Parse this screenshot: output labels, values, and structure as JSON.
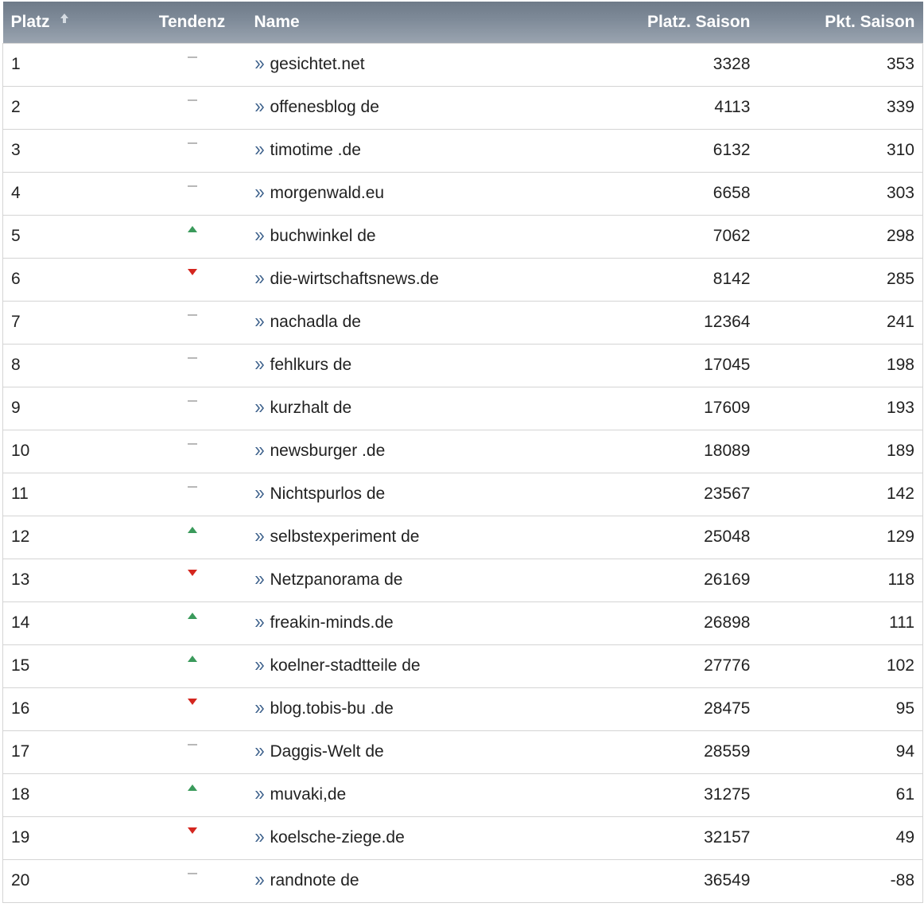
{
  "table": {
    "headers": {
      "platz": "Platz",
      "tendenz": "Tendenz",
      "name": "Name",
      "platz_saison": "Platz. Saison",
      "pkt_saison": "Pkt. Saison"
    },
    "sort_icon": "sort-up-arrow-icon",
    "trend_icons": {
      "same": "dash-icon",
      "up": "triangle-up-icon",
      "down": "triangle-down-icon"
    },
    "colors": {
      "header_bg": "#7f8b99",
      "trend_up": "#3a9a5b",
      "trend_down": "#d4261f",
      "trend_same": "#b8b8b8",
      "link_icon": "#3b5f8a"
    },
    "rows": [
      {
        "platz": "1",
        "trend": "same",
        "name": "gesichtet.net",
        "platz_saison": "3328",
        "pkt_saison": "353"
      },
      {
        "platz": "2",
        "trend": "same",
        "name": "offenesblog de",
        "platz_saison": "4113",
        "pkt_saison": "339"
      },
      {
        "platz": "3",
        "trend": "same",
        "name": "timotime .de",
        "platz_saison": "6132",
        "pkt_saison": "310"
      },
      {
        "platz": "4",
        "trend": "same",
        "name": "morgenwald.eu",
        "platz_saison": "6658",
        "pkt_saison": "303"
      },
      {
        "platz": "5",
        "trend": "up",
        "name": "buchwinkel de",
        "platz_saison": "7062",
        "pkt_saison": "298"
      },
      {
        "platz": "6",
        "trend": "down",
        "name": "die-wirtschaftsnews.de",
        "platz_saison": "8142",
        "pkt_saison": "285"
      },
      {
        "platz": "7",
        "trend": "same",
        "name": "nachadla de",
        "platz_saison": "12364",
        "pkt_saison": "241"
      },
      {
        "platz": "8",
        "trend": "same",
        "name": "fehlkurs de",
        "platz_saison": "17045",
        "pkt_saison": "198"
      },
      {
        "platz": "9",
        "trend": "same",
        "name": "kurzhalt de",
        "platz_saison": "17609",
        "pkt_saison": "193"
      },
      {
        "platz": "10",
        "trend": "same",
        "name": "newsburger .de",
        "platz_saison": "18089",
        "pkt_saison": "189"
      },
      {
        "platz": "11",
        "trend": "same",
        "name": "Nichtspurlos de",
        "platz_saison": "23567",
        "pkt_saison": "142"
      },
      {
        "platz": "12",
        "trend": "up",
        "name": "selbstexperiment de",
        "platz_saison": "25048",
        "pkt_saison": "129"
      },
      {
        "platz": "13",
        "trend": "down",
        "name": "Netzpanorama de",
        "platz_saison": "26169",
        "pkt_saison": "118"
      },
      {
        "platz": "14",
        "trend": "up",
        "name": "freakin-minds.de",
        "platz_saison": "26898",
        "pkt_saison": "111"
      },
      {
        "platz": "15",
        "trend": "up",
        "name": "koelner-stadtteile de",
        "platz_saison": "27776",
        "pkt_saison": "102"
      },
      {
        "platz": "16",
        "trend": "down",
        "name": "blog.tobis-bu .de",
        "platz_saison": "28475",
        "pkt_saison": "95"
      },
      {
        "platz": "17",
        "trend": "same",
        "name": "Daggis-Welt de",
        "platz_saison": "28559",
        "pkt_saison": "94"
      },
      {
        "platz": "18",
        "trend": "up",
        "name": "muvaki,de",
        "platz_saison": "31275",
        "pkt_saison": "61"
      },
      {
        "platz": "19",
        "trend": "down",
        "name": "koelsche-ziege.de",
        "platz_saison": "32157",
        "pkt_saison": "49"
      },
      {
        "platz": "20",
        "trend": "same",
        "name": "randnote de",
        "platz_saison": "36549",
        "pkt_saison": "-88"
      }
    ]
  }
}
